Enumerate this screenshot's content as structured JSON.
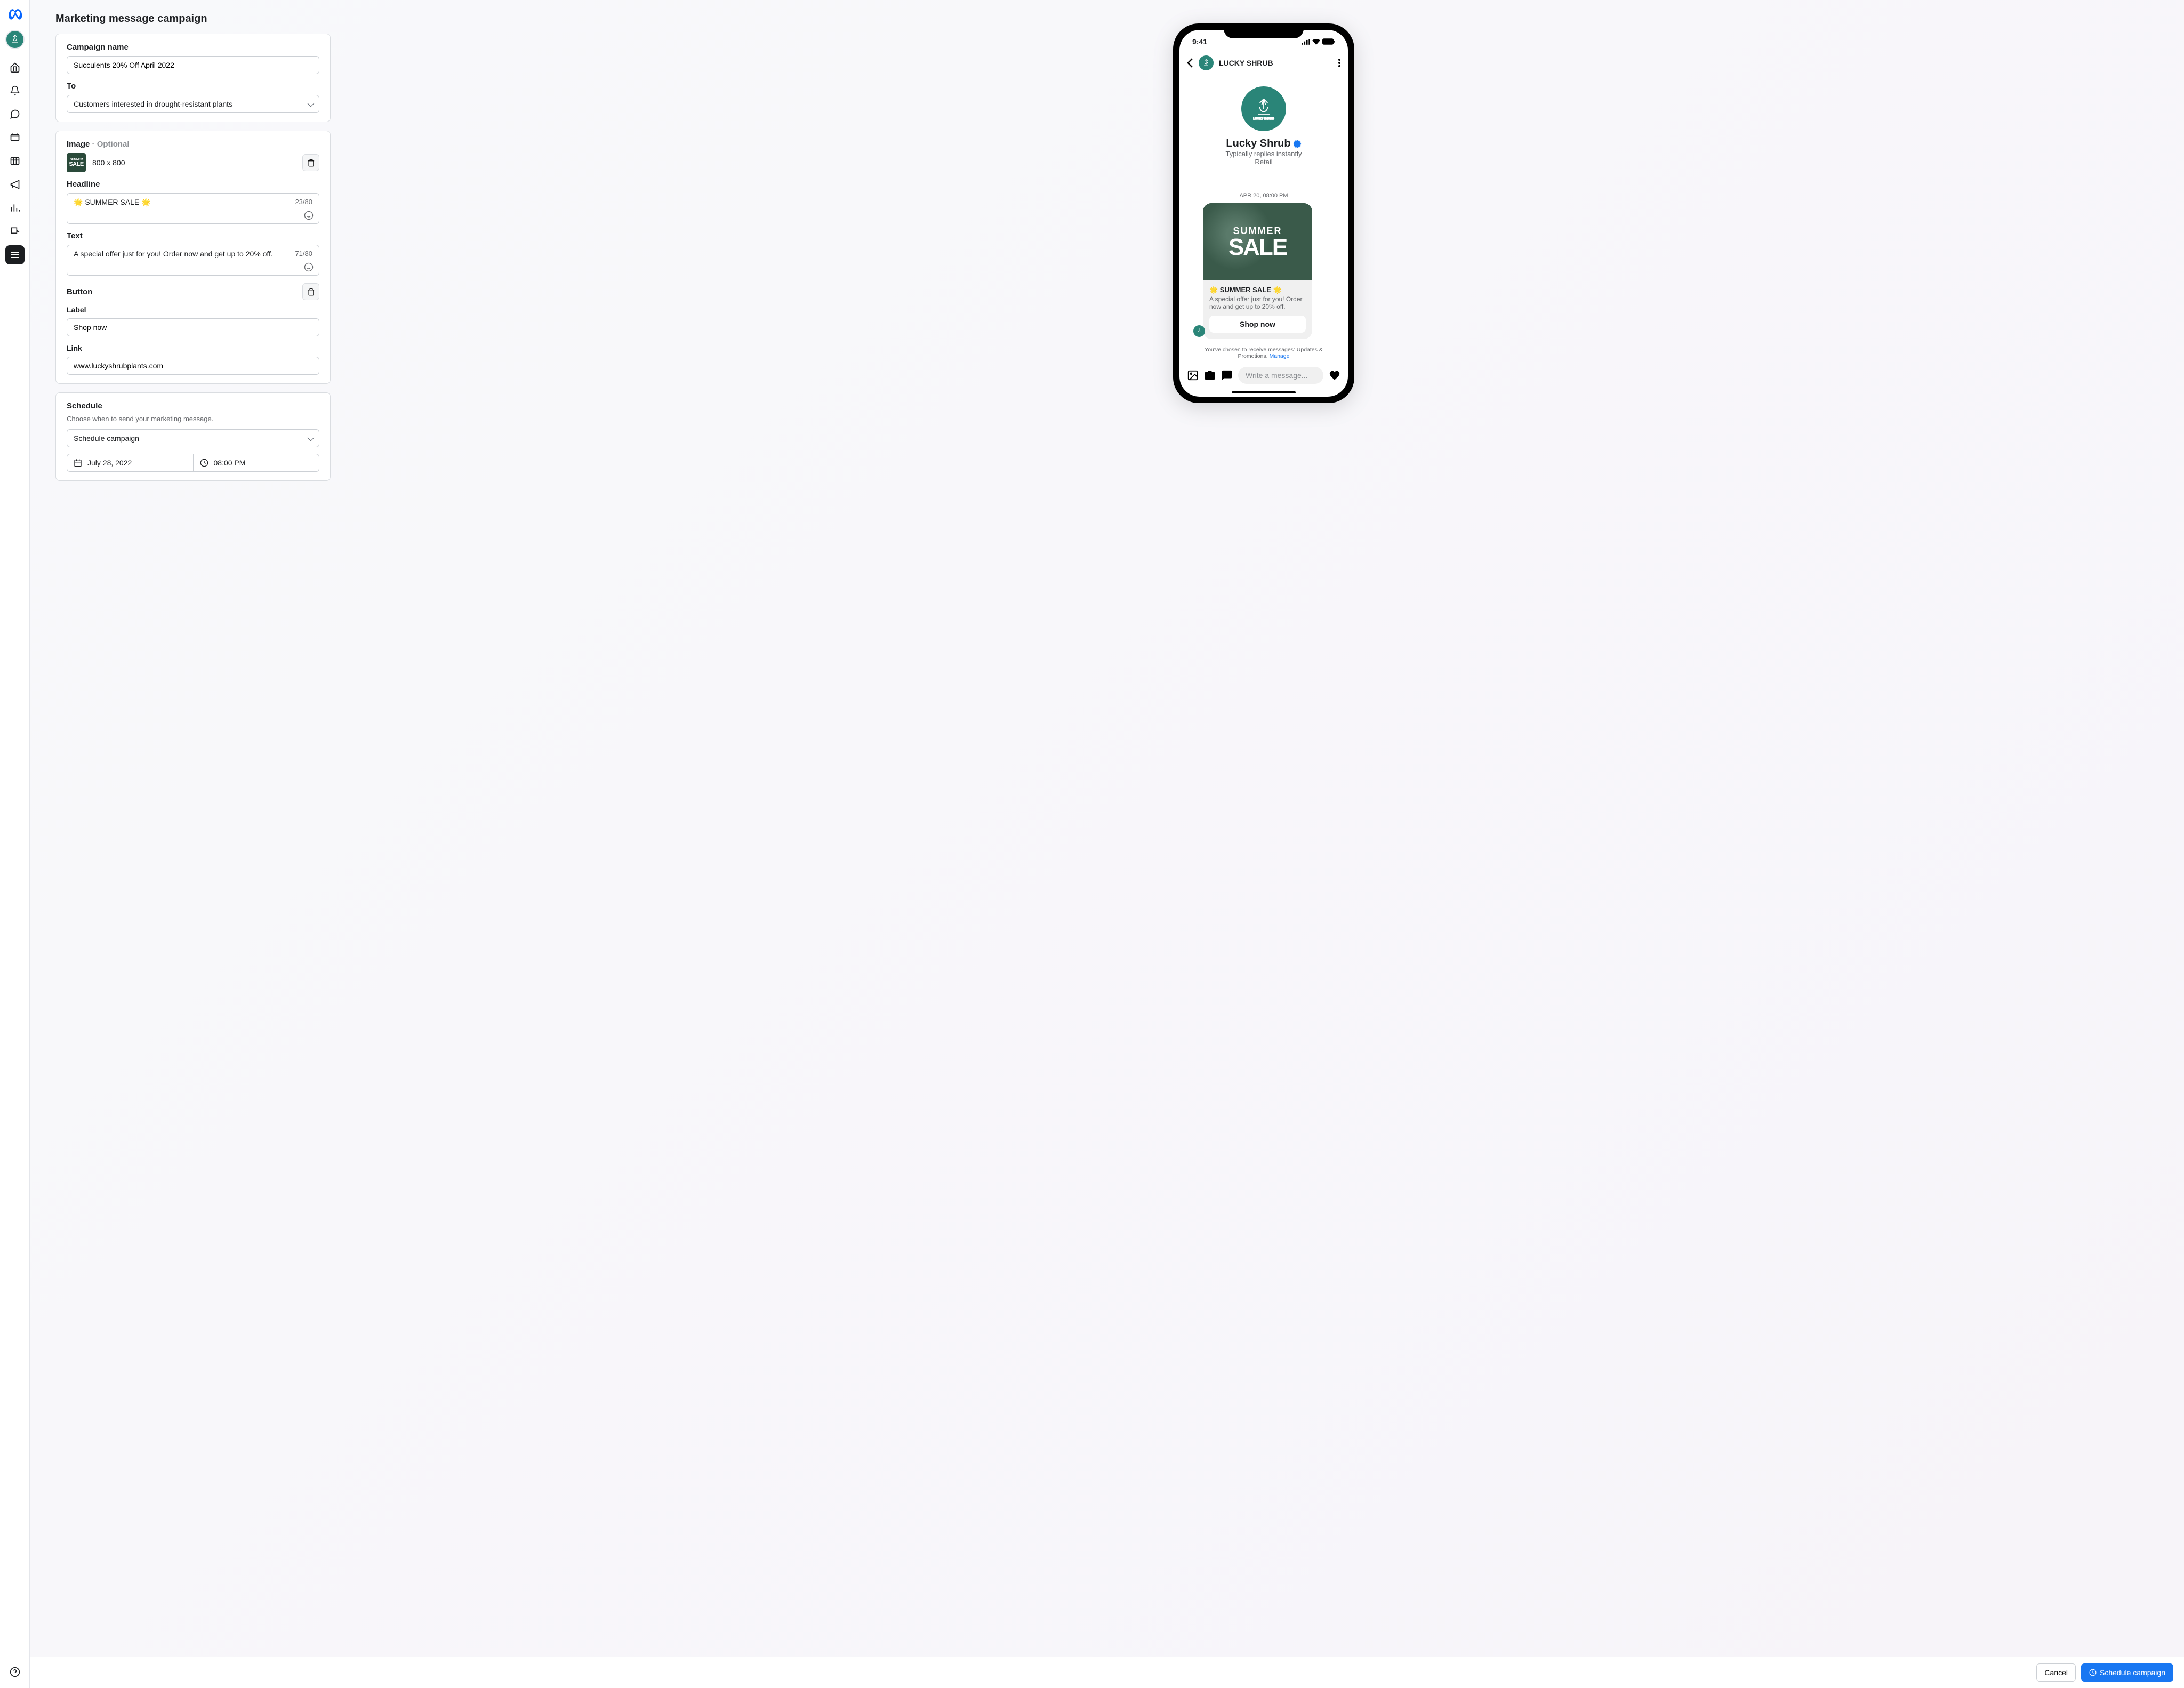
{
  "page": {
    "title": "Marketing message campaign"
  },
  "form": {
    "campaign_name": {
      "label": "Campaign name",
      "value": "Succulents 20% Off April 2022"
    },
    "to": {
      "label": "To",
      "value": "Customers interested in drought-resistant plants"
    },
    "image": {
      "label": "Image",
      "optional": "Optional",
      "dimensions": "800 x 800",
      "thumb_l1": "SUMMER",
      "thumb_l2": "SALE"
    },
    "headline": {
      "label": "Headline",
      "value": "🌟 SUMMER SALE 🌟",
      "count": "23/80"
    },
    "text": {
      "label": "Text",
      "value": "A special offer just for you! Order now and get up to 20% off.",
      "count": "71/80"
    },
    "button": {
      "label": "Button",
      "label_field": "Label",
      "label_value": "Shop now",
      "link_field": "Link",
      "link_value": "www.luckyshrubplants.com"
    },
    "schedule": {
      "label": "Schedule",
      "sub": "Choose when to send your marketing message.",
      "option": "Schedule campaign",
      "date": "July 28, 2022",
      "time": "08:00 PM"
    }
  },
  "footer": {
    "cancel": "Cancel",
    "submit": "Schedule campaign"
  },
  "preview": {
    "status_time": "9:41",
    "chat_title": "LUCKY SHRUB",
    "biz_name": "Lucky Shrub",
    "biz_reply": "Typically replies instantly",
    "biz_category": "Retail",
    "msg_time": "APR 20, 08:00 PM",
    "img_t1": "SUMMER",
    "img_t2": "SALE",
    "headline": "🌟 SUMMER SALE 🌟",
    "text": "A special offer just for you! Order now and get up to 20% off.",
    "button": "Shop now",
    "disclaimer_pre": "You've chosen to receive messages: Updates & Promotions. ",
    "disclaimer_link": "Manage",
    "input_placeholder": "Write a message..."
  }
}
